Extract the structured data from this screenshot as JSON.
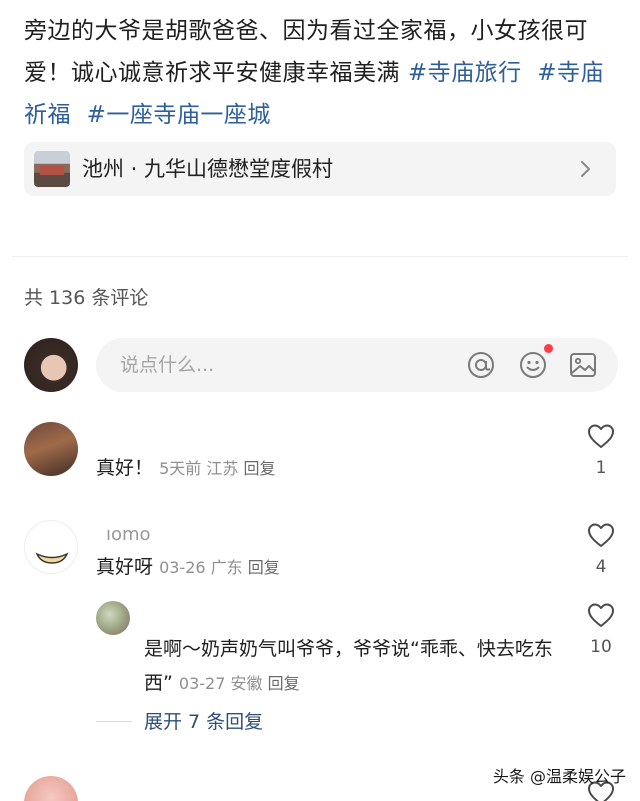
{
  "post": {
    "text": "旁边的大爷是胡歌爸爸、因为看过全家福，小女孩很可爱！诚心诚意祈求平安健康幸福美满 ",
    "tags": [
      "#寺庙旅行",
      "#寺庙祈福",
      "#一座寺庙一座城"
    ]
  },
  "location": {
    "label": "池州 · 九华山德懋堂度假村"
  },
  "comments_header": {
    "count_text": "共 136 条评论"
  },
  "comment_input": {
    "placeholder": "说点什么..."
  },
  "comments": [
    {
      "name": "",
      "text": "真好！",
      "time": "5天前",
      "region": "江苏",
      "reply_label": "回复",
      "likes": "1"
    },
    {
      "name": "ıomo",
      "text": "真好呀",
      "time": "03-26",
      "region": "广东",
      "reply_label": "回复",
      "likes": "4"
    }
  ],
  "reply": {
    "name": "",
    "text": "是啊～奶声奶气叫爷爷，爷爷说“乖乖、快去吃东西”",
    "time": "03-27",
    "region": "安徽",
    "reply_label": "回复",
    "likes": "10"
  },
  "expand_replies": {
    "label": "展开 7 条回复"
  },
  "watermark": {
    "text": "头条 @温柔娱公子"
  },
  "colors": {
    "tag": "#2f5f9b",
    "notify_dot": "#ff3b4a"
  }
}
